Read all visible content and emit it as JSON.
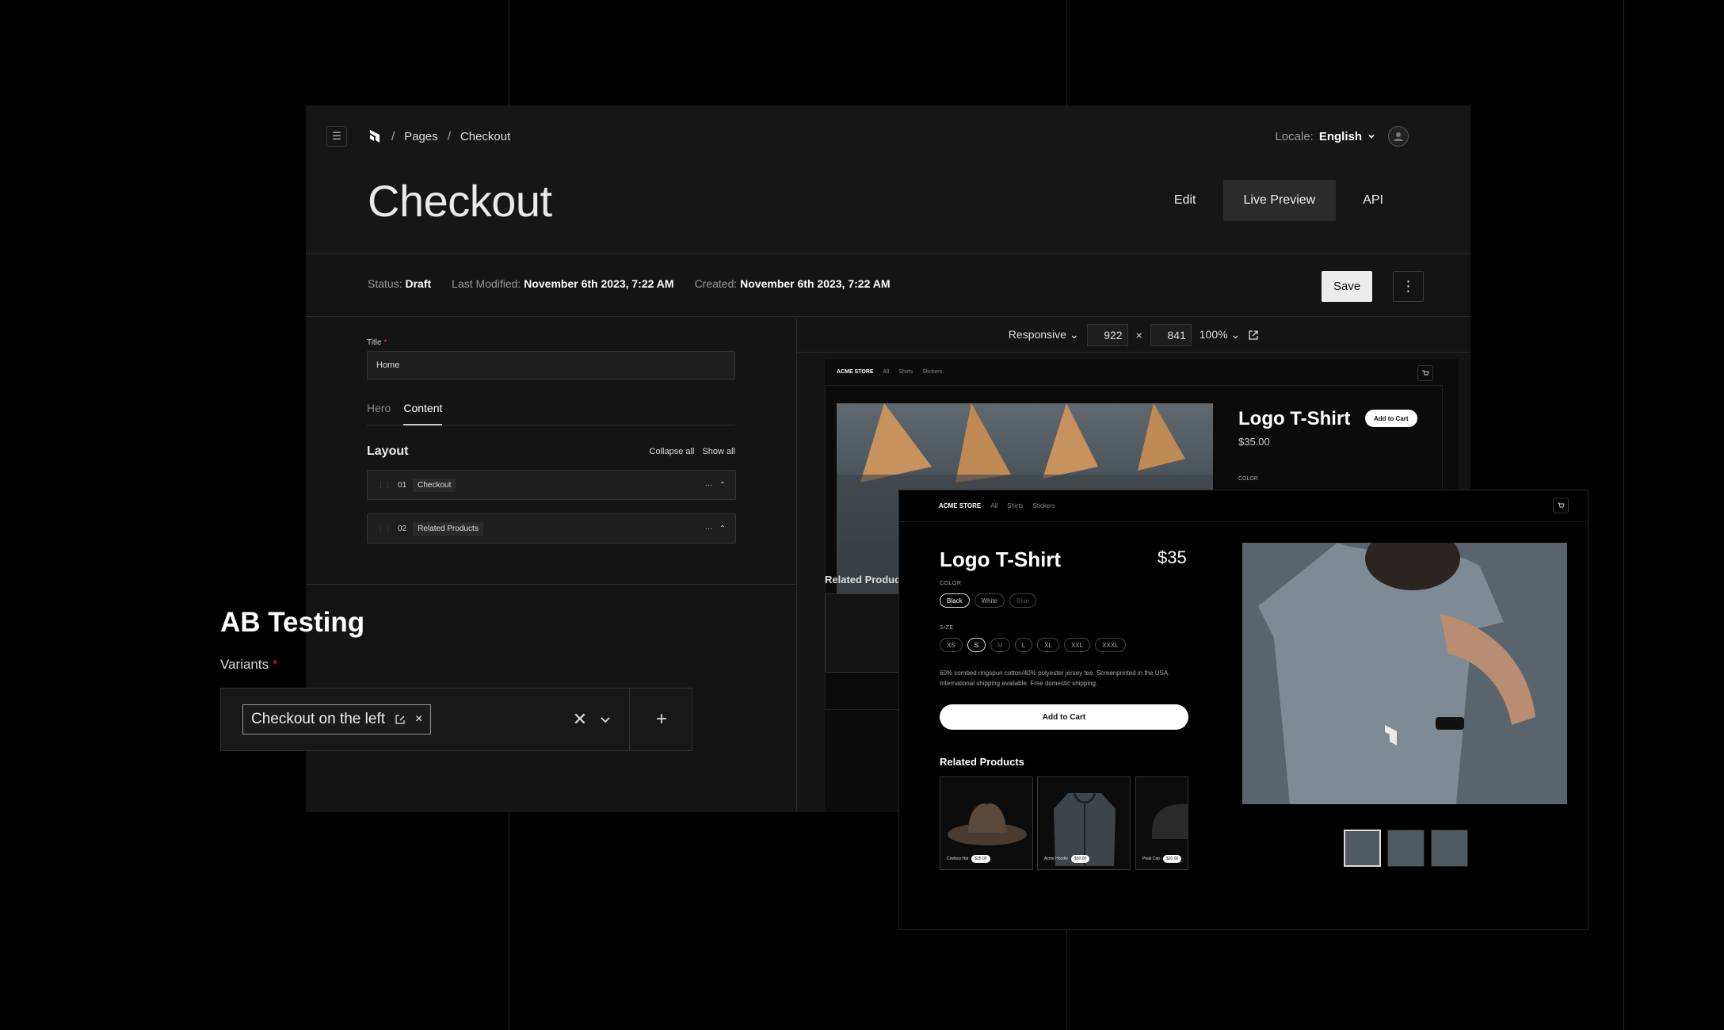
{
  "header": {
    "breadcrumb": [
      "Pages",
      "Checkout"
    ],
    "separator": "/",
    "locale_label": "Locale:",
    "locale_value": "English",
    "page_title": "Checkout",
    "view_tabs": [
      "Edit",
      "Live Preview",
      "API"
    ],
    "active_view_tab": "Live Preview"
  },
  "meta": {
    "status_label": "Status:",
    "status_value": "Draft",
    "modified_label": "Last Modified:",
    "modified_value": "November 6th 2023, 7:22 AM",
    "created_label": "Created:",
    "created_value": "November 6th 2023, 7:22 AM",
    "save_label": "Save"
  },
  "editor": {
    "title_label": "Title",
    "required_mark": "*",
    "title_value": "Home",
    "tabs": [
      "Hero",
      "Content"
    ],
    "active_tab": "Content",
    "layout_title": "Layout",
    "collapse_all": "Collapse all",
    "show_all": "Show all",
    "blocks": [
      {
        "index": "01",
        "name": "Checkout"
      },
      {
        "index": "02",
        "name": "Related Products"
      }
    ]
  },
  "preview_toolbar": {
    "mode": "Responsive",
    "width": "922",
    "times": "×",
    "height": "841",
    "zoom": "100%"
  },
  "store_back": {
    "brand": "ACME STORE",
    "nav": [
      "All",
      "Shirts",
      "Stickers"
    ],
    "product_title": "Logo T-Shirt",
    "price": "$35.00",
    "add_to_cart": "Add to Cart",
    "color_label": "COLOR",
    "related_title": "Related Products"
  },
  "store_front": {
    "brand": "ACME STORE",
    "nav": [
      "All",
      "Shirts",
      "Stickers"
    ],
    "product_title": "Logo T-Shirt",
    "price": "$35",
    "color_label": "COLOR",
    "colors": [
      "Black",
      "White",
      "Blue"
    ],
    "selected_color": "Black",
    "size_label": "SIZE",
    "sizes": [
      "XS",
      "S",
      "M",
      "L",
      "XL",
      "XXL",
      "XXXL"
    ],
    "selected_size": "S",
    "disabled_size": "M",
    "description": "60% combed ringspun cotton/40% polyester jersey tee. Screenprinted in the USA. International shipping available. Free domestic shipping.",
    "add_to_cart": "Add to Cart",
    "related_title": "Related Products",
    "related": [
      {
        "name": "Cowboy Hat",
        "price": "$25.00"
      },
      {
        "name": "Acme Hoodie",
        "price": "$50.00"
      },
      {
        "name": "Peak Cap",
        "price": "$20.00"
      }
    ]
  },
  "ab_testing": {
    "title": "AB Testing",
    "variants_label": "Variants",
    "required_mark": "*",
    "selected_variant": "Checkout on the left"
  },
  "colors": {
    "background": "#000000",
    "panel": "#141414",
    "accent": "#ffffff",
    "required": "#dd2233"
  }
}
